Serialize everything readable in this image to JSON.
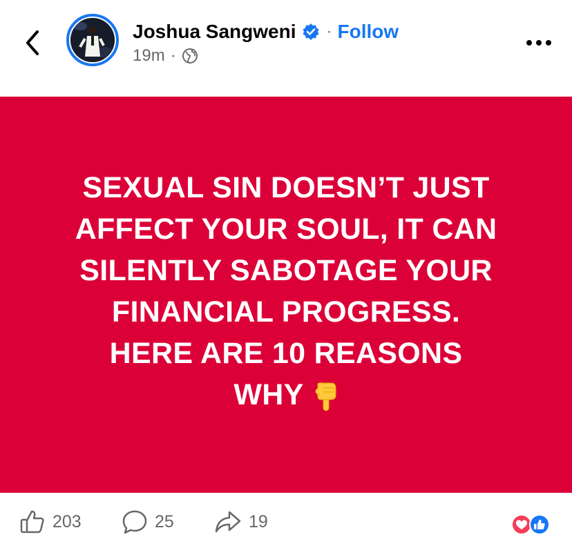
{
  "header": {
    "author_name": "Joshua Sangweni",
    "separator": "·",
    "follow_label": "Follow",
    "time_ago": "19m",
    "meta_separator": "·",
    "verified_icon": "verified-badge-icon",
    "audience_icon": "globe-icon"
  },
  "post": {
    "background_color": "#dc0038",
    "text_lines": [
      "SEXUAL SIN DOESN’T JUST",
      "AFFECT YOUR SOUL, IT CAN",
      "SILENTLY SABOTAGE YOUR",
      "FINANCIAL PROGRESS.",
      "HERE ARE 10 REASONS",
      "WHY"
    ],
    "emoji": "pointing-down-emoji"
  },
  "footer": {
    "likes_count": "203",
    "comments_count": "25",
    "shares_count": "19",
    "reaction_icons": [
      "love-reaction-icon",
      "like-reaction-icon"
    ]
  },
  "colors": {
    "accent": "#1877f2",
    "post_bg": "#dc0038",
    "muted_text": "#65676b",
    "love": "#f33e58"
  }
}
